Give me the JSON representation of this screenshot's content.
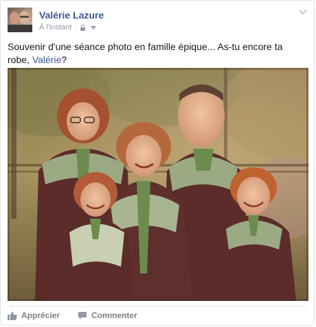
{
  "post": {
    "author": "Valérie Lazure",
    "timestamp": "À l'instant",
    "privacy_icon": "lock-icon",
    "text_before": "Souvenir d'une séance photo en famille épique... As-tu encore ta robe, ",
    "mention": "Valérie",
    "text_after": "?"
  },
  "actions": {
    "like_label": "Apprécier",
    "comment_label": "Commenter"
  },
  "colors": {
    "link": "#3b5998",
    "meta": "#9197a3",
    "action": "#7f7f7f"
  }
}
